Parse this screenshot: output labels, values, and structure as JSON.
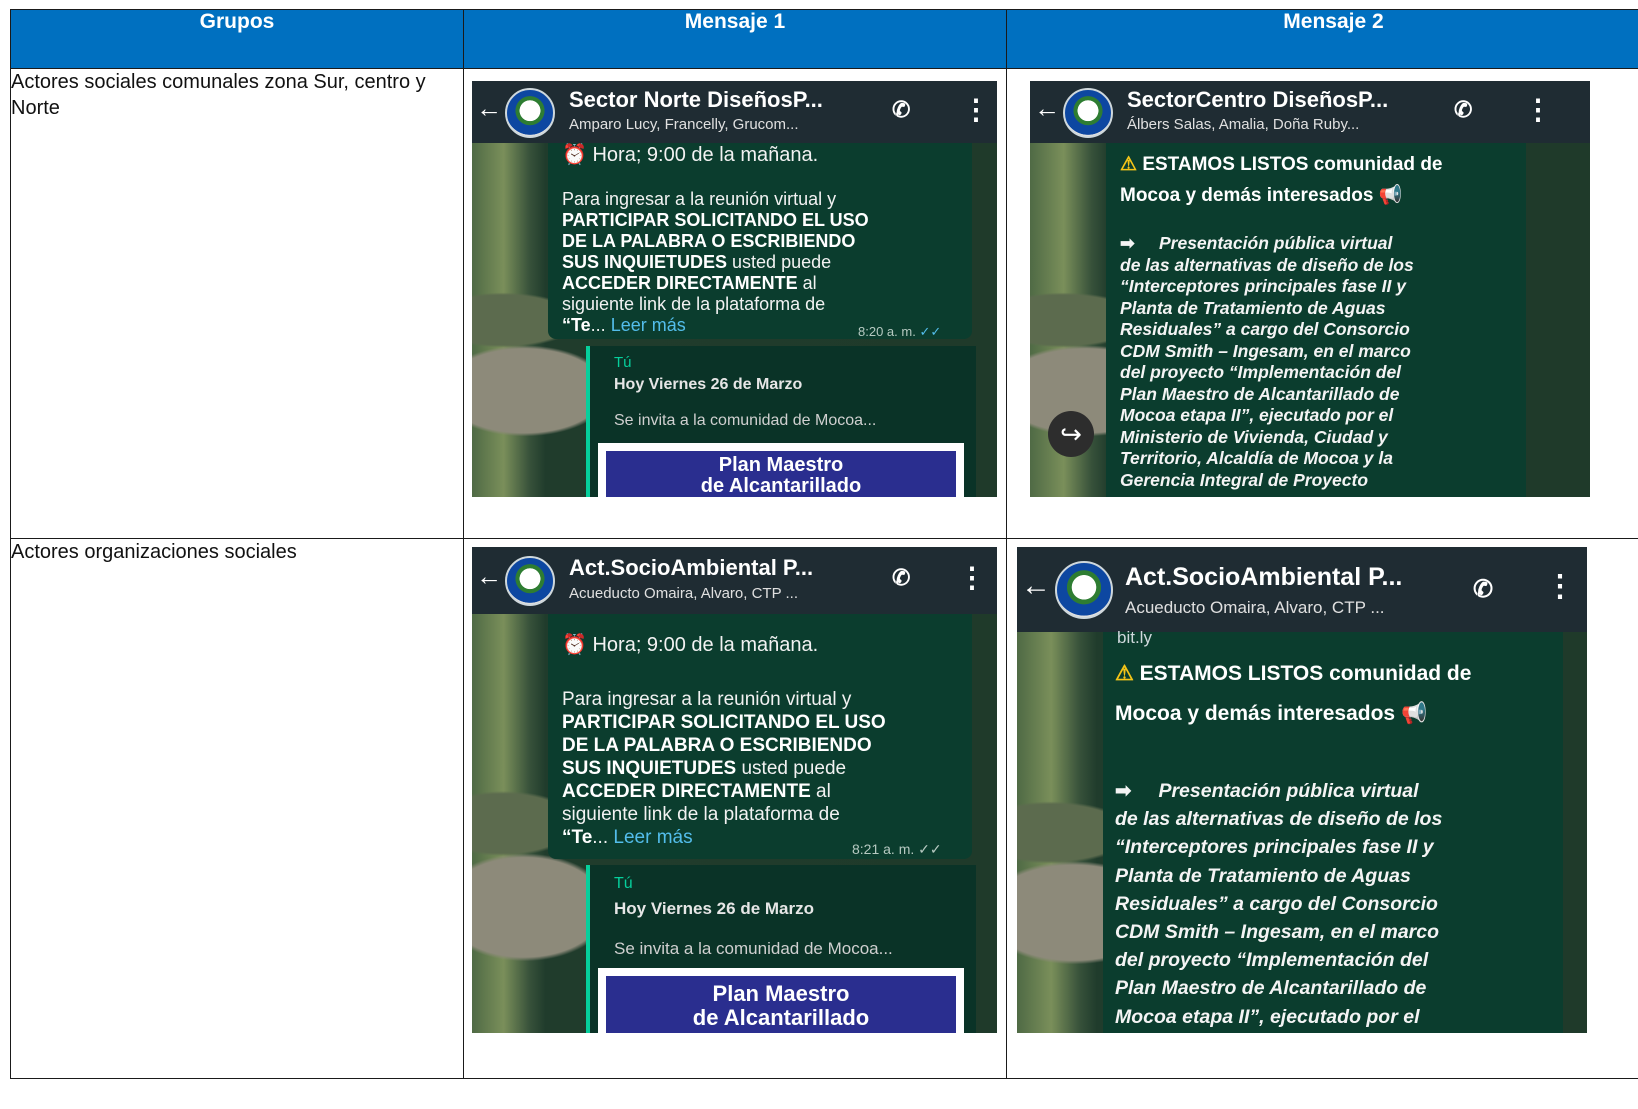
{
  "table": {
    "headers": [
      "Grupos",
      "Mensaje 1",
      "Mensaje 2"
    ],
    "rows": [
      {
        "group": "Actores sociales comunales zona Sur, centro y Norte"
      },
      {
        "group": "Actores organizaciones sociales"
      }
    ]
  },
  "r1m1": {
    "title": "Sector Norte DiseñosP...",
    "subtitle": "Amparo Lucy, Francelly, Grucom...",
    "hora": "Hora; 9:00 de la mañana.",
    "p1": "Para ingresar a la reunión virtual y",
    "p2": "PARTICIPAR SOLICITANDO EL USO",
    "p3": "DE LA PALABRA O ESCRIBIENDO",
    "p4a": "SUS INQUIETUDES",
    "p4b": " usted puede",
    "p5a": "ACCEDER DIRECTAMENTE",
    "p5b": " al",
    "p6": "siguiente link de la plataforma de",
    "p7a": "“Te",
    "p7b": "... ",
    "leer": "Leer más",
    "time": "8:20 a. m.",
    "quote_author": "Tú",
    "quote_title": "Hoy Viernes 26 de Marzo",
    "quote_text": "Se invita a la comunidad de Mocoa...",
    "card1": "Plan Maestro",
    "card2": "de Alcantarillado"
  },
  "r1m2": {
    "title": "SectorCentro DiseñosP...",
    "subtitle": "Álbers Salas, Amalia, Doña Ruby...",
    "l1": "ESTAMOS LISTOS comunidad de",
    "l2": "Mocoa y demás interesados",
    "l3": "Presentación pública virtual",
    "l4": "de las alternativas de diseño de los",
    "l5": "“Interceptores principales fase II y",
    "l6": "Planta de Tratamiento de Aguas",
    "l7": "Residuales” a cargo del Consorcio",
    "l8": "CDM Smith – Ingesam, en el marco",
    "l9": "del proyecto “Implementación del",
    "l10": "Plan Maestro de Alcantarillado de",
    "l11": "Mocoa etapa II”, ejecutado por el",
    "l12": "Ministerio de Vivienda, Ciudad y",
    "l13": "Territorio, Alcaldía de Mocoa y la",
    "l14": "Gerencia Integral de Proyecto"
  },
  "r2m1": {
    "title": "Act.SocioAmbiental P...",
    "subtitle": "Acueducto Omaira, Alvaro, CTP ...",
    "hora": "Hora; 9:00 de la mañana.",
    "p1": "Para ingresar a la reunión virtual y",
    "p2": "PARTICIPAR SOLICITANDO EL USO",
    "p3": "DE LA PALABRA O ESCRIBIENDO",
    "p4a": "SUS INQUIETUDES",
    "p4b": " usted puede",
    "p5a": "ACCEDER DIRECTAMENTE",
    "p5b": " al",
    "p6": "siguiente link de la plataforma de",
    "p7a": "“Te",
    "p7b": "... ",
    "leer": "Leer más",
    "time": "8:21 a. m.",
    "quote_author": "Tú",
    "quote_title": "Hoy Viernes 26 de Marzo",
    "quote_text": "Se invita a la comunidad de Mocoa...",
    "card1": "Plan Maestro",
    "card2": "de Alcantarillado"
  },
  "r2m2": {
    "title": "Act.SocioAmbiental P...",
    "subtitle": "Acueducto Omaira, Alvaro, CTP ...",
    "bitly": "bit.ly",
    "l1": "ESTAMOS LISTOS comunidad de",
    "l2": "Mocoa y demás interesados",
    "l3": "Presentación pública virtual",
    "l4": "de las alternativas de diseño de los",
    "l5": "“Interceptores principales fase II y",
    "l6": "Planta de Tratamiento de Aguas",
    "l7": "Residuales” a cargo del Consorcio",
    "l8": "CDM Smith – Ingesam, en el marco",
    "l9": "del proyecto “Implementación del",
    "l10": "Plan Maestro de Alcantarillado de",
    "l11": "Mocoa etapa II”, ejecutado por el"
  },
  "icons": {
    "back": "←",
    "call": "📞+",
    "menu": "⋮",
    "alarm": "⏰",
    "warning": "⚠",
    "megaphone": "📢",
    "arrow": "➡",
    "share": "↪"
  }
}
